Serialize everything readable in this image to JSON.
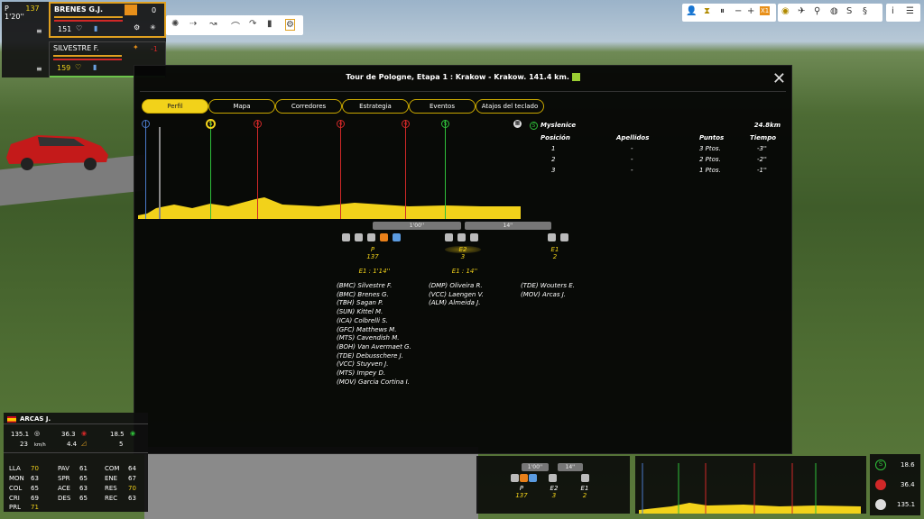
{
  "top_left": {
    "group": {
      "label": "P",
      "count": "137",
      "gap": "1'20''"
    },
    "riders": [
      {
        "name": "BRENES G.J.",
        "number": "151",
        "value": "0"
      },
      {
        "name": "SILVESTRE F.",
        "number": "159",
        "value": "-1"
      }
    ]
  },
  "modal": {
    "title": "Tour de Pologne, Etapa 1 : Krakow - Krakow. 141.4 km.",
    "tabs": [
      "Perfil",
      "Mapa",
      "Corredores",
      "Estrategia",
      "Eventos",
      "Atajos del teclado"
    ],
    "active_tab": "Perfil",
    "sprint": {
      "name": "Myslenice",
      "distance": "24.8km",
      "headers": [
        "Posición",
        "Apellidos",
        "Puntos",
        "Tiempo"
      ],
      "rows": [
        {
          "pos": "1",
          "name": "-",
          "pts": "3 Ptos.",
          "time": "-3''"
        },
        {
          "pos": "2",
          "name": "-",
          "pts": "2 Ptos.",
          "time": "-2''"
        },
        {
          "pos": "3",
          "name": "-",
          "pts": "1 Ptos.",
          "time": "-1''"
        }
      ]
    },
    "gaps": [
      "1'00''",
      "14''"
    ],
    "groups": [
      {
        "label": "P",
        "count": "137",
        "time": "E1 : 1'14''",
        "riders": [
          "(BMC) Silvestre F.",
          "(BMC) Brenes G.",
          "(TBH) Sagan P.",
          "(SUN) Kittel M.",
          "(ICA) Colbrelli S.",
          "(GFC) Matthews M.",
          "(MTS) Cavendish M.",
          "(BOH) Van Avermaet G.",
          "(TDE) Debusschere J.",
          "(VCC) Stuyven J.",
          "(MTS) Impey D.",
          "(MOV) Garcia Cortina I."
        ]
      },
      {
        "label": "E2",
        "count": "3",
        "time": "E1 : 14''",
        "riders": [
          "(DMP) Oliveira R.",
          "(VCC) Laengen V.",
          "(ALM) Almeida J."
        ]
      },
      {
        "label": "E1",
        "count": "2",
        "time": "",
        "riders": [
          "(TDE) Wouters E.",
          "(MOV) Arcas J."
        ]
      }
    ]
  },
  "bottom_left": {
    "name": "ARCAS J.",
    "dist": "135.1",
    "speed": "23",
    "speed_unit": "km/h",
    "v1": "36.3",
    "v2": "4.4",
    "v3": "18.5",
    "v4": "5",
    "stats": [
      [
        "LLA",
        "70"
      ],
      [
        "MON",
        "63"
      ],
      [
        "COL",
        "65"
      ],
      [
        "CRI",
        "69"
      ],
      [
        "PRL",
        "71"
      ],
      [
        "PAV",
        "61"
      ],
      [
        "SPR",
        "65"
      ],
      [
        "ACE",
        "63"
      ],
      [
        "DES",
        "65"
      ],
      [
        "COM",
        "64"
      ],
      [
        "ENE",
        "67"
      ],
      [
        "RES",
        "70"
      ],
      [
        "REC",
        "63"
      ]
    ]
  },
  "bottom_mid": {
    "gaps": [
      "1'00''",
      "14''"
    ],
    "groups": [
      {
        "l": "P",
        "c": "137"
      },
      {
        "l": "E2",
        "c": "3"
      },
      {
        "l": "E1",
        "c": "2"
      }
    ]
  },
  "bottom_right": {
    "s": "18.6",
    "m": "36.4",
    "f": "135.1"
  },
  "colors": {
    "accent": "#f2d21a",
    "green": "#2fbf3a",
    "red": "#d02828"
  }
}
